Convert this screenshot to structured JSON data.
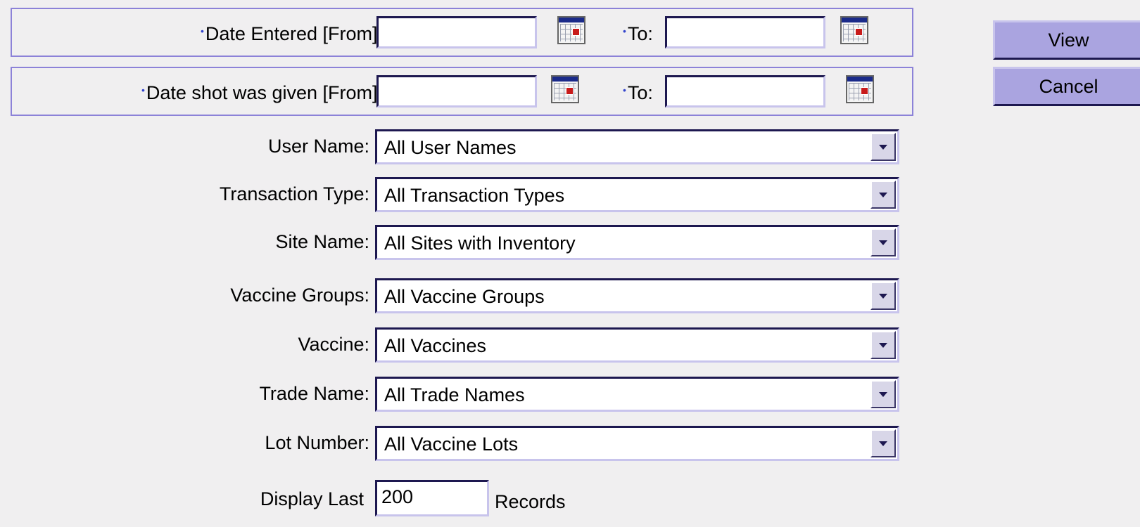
{
  "date_entered": {
    "from_label": "Date Entered [From]:",
    "to_label": "To:",
    "from_value": "",
    "to_value": ""
  },
  "date_shot": {
    "from_label": "Date shot was given [From]:",
    "to_label": "To:",
    "from_value": "",
    "to_value": ""
  },
  "filters": {
    "user_name": {
      "label": "User Name:",
      "value": "All User Names"
    },
    "transaction_type": {
      "label": "Transaction Type:",
      "value": "All Transaction Types"
    },
    "site_name": {
      "label": "Site Name:",
      "value": "All Sites with Inventory"
    },
    "vaccine_groups": {
      "label": "Vaccine Groups:",
      "value": "All Vaccine Groups"
    },
    "vaccine": {
      "label": "Vaccine:",
      "value": "All Vaccines"
    },
    "trade_name": {
      "label": "Trade Name:",
      "value": "All Trade Names"
    },
    "lot_number": {
      "label": "Lot Number:",
      "value": "All Vaccine Lots"
    }
  },
  "display": {
    "label": "Display Last",
    "value": "200",
    "suffix": "Records"
  },
  "buttons": {
    "view": "View",
    "cancel": "Cancel"
  },
  "icons": {
    "calendar": "calendar-icon",
    "dropdown": "chevron-down-icon",
    "required": "required-dot-icon"
  },
  "colors": {
    "accent": "#aaa4e0",
    "border_dark": "#1d1850",
    "panel_border": "#8c82d8",
    "required_dot": "#3344cc"
  }
}
